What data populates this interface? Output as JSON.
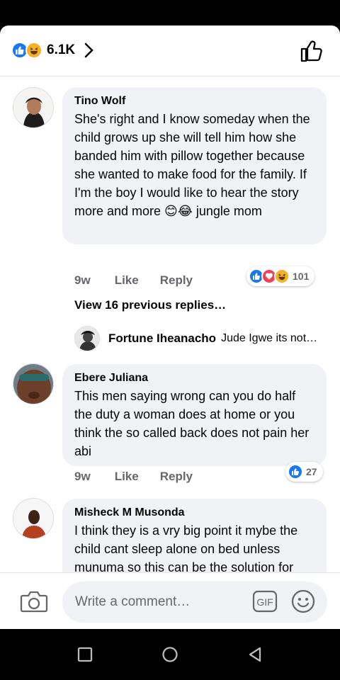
{
  "header": {
    "reaction_count": "6.1K",
    "reactions": [
      "like-icon",
      "haha-icon"
    ]
  },
  "comments": [
    {
      "author": "Tino Wolf",
      "text": "She's right and I know someday when the child grows up she will tell him how she banded him with pillow together because she wanted to make food for the family. If I'm the boy I would  like to hear the story more and more 😊😂 jungle mom",
      "time": "9w",
      "like_label": "Like",
      "reply_label": "Reply",
      "reaction_count": "101",
      "reactions": [
        "like-icon",
        "love-icon",
        "haha-icon"
      ]
    },
    {
      "author": "Ebere Juliana",
      "text": "This men saying wrong can you do half the duty a woman does at home or you think the so called back does not pain her abi",
      "time": "9w",
      "like_label": "Like",
      "reply_label": "Reply",
      "reaction_count": "27",
      "reactions": [
        "like-icon"
      ]
    },
    {
      "author": "Misheck M Musonda",
      "text": "I think they is a vry big point it mybe the child cant sleep alone on bed unless munuma so this can be the solution for her to work at home"
    }
  ],
  "replies_thread": {
    "view_previous": "View 16 previous replies…",
    "reply_author": "Fortune Iheanacho",
    "reply_snippet": "Jude Igwe its not…"
  },
  "composer": {
    "placeholder": "Write a comment…",
    "gif_label": "GIF"
  },
  "colors": {
    "brand_blue": "#1877f2",
    "love_red": "#f33e58",
    "haha_yellow": "#f7b125",
    "bubble_bg": "#f0f2f5",
    "meta_gray": "#65676b"
  }
}
